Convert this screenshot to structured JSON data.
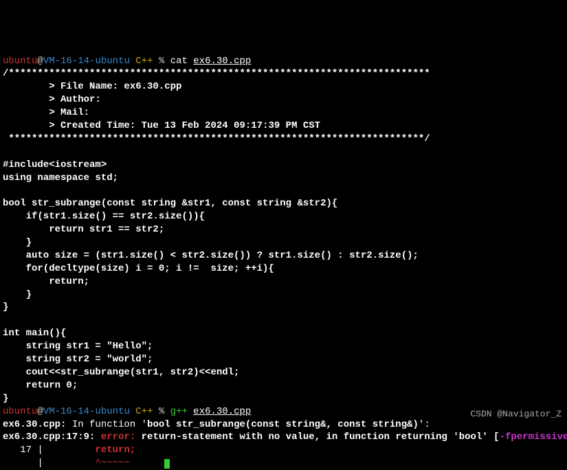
{
  "prompt1": {
    "user": "ubuntu",
    "at": "@",
    "host": "VM-16-14-ubuntu",
    "dir": " C++ ",
    "pct": "% ",
    "cmd": "cat ",
    "file": "ex6.30.cpp"
  },
  "code": {
    "l1": "/*************************************************************************",
    "l2": "        > File Name: ex6.30.cpp",
    "l3": "        > Author:",
    "l4": "        > Mail:",
    "l5": "        > Created Time: Tue 13 Feb 2024 09:17:39 PM CST",
    "l6": " ************************************************************************/",
    "l7": "",
    "l8": "#include<iostream>",
    "l9": "using namespace std;",
    "l10": "",
    "l11": "bool str_subrange(const string &str1, const string &str2){",
    "l12": "    if(str1.size() == str2.size()){",
    "l13": "        return str1 == str2;",
    "l14": "    }",
    "l15": "    auto size = (str1.size() < str2.size()) ? str1.size() : str2.size();",
    "l16": "    for(decltype(size) i = 0; i !=  size; ++i){",
    "l17": "        return;",
    "l18": "    }",
    "l19": "}",
    "l20": "",
    "l21": "int main(){",
    "l22": "    string str1 = \"Hello\";",
    "l23": "    string str2 = \"world\";",
    "l24": "    cout<<str_subrange(str1, str2)<<endl;",
    "l25": "    return 0;",
    "l26": "}"
  },
  "prompt2": {
    "user": "ubuntu",
    "at": "@",
    "host": "VM-16-14-ubuntu",
    "dir": " C++ ",
    "pct": "% ",
    "cmd": "g++ ",
    "file": "ex6.30.cpp"
  },
  "compile": {
    "loc1": "ex6.30.cpp:",
    "msg1a": " In function '",
    "msg1b": "bool str_subrange(const string&, const string&)",
    "msg1c": "':",
    "loc2": "ex6.30.cpp:17:9:",
    "err_label": "error:",
    "msg2a": "return-statement with no value, in function returning '",
    "msg2b": "bool",
    "msg2c": "' [",
    "flag": "-fpermissive",
    "msg2d": "]",
    "ctx_num": "   17 |",
    "ctx_code": "         return;",
    "caret_pre": "      |",
    "caret": "         ^~~~~~"
  },
  "watermark": "CSDN @Navigator_Z"
}
